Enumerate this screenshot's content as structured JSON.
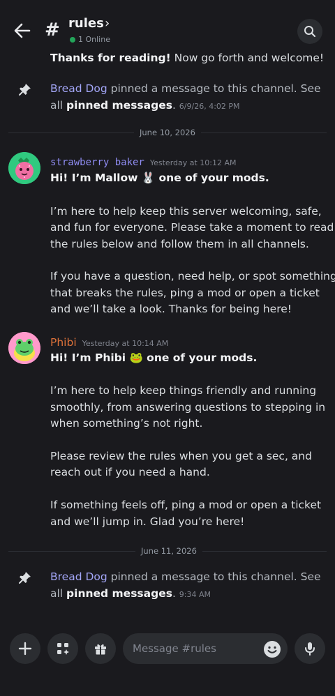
{
  "header": {
    "channel_name": "rules",
    "chevron": "›",
    "online_text": "1 Online"
  },
  "top_message": {
    "bold": "Thanks for reading!",
    "rest": " Now go forth and welcome!"
  },
  "pin_1": {
    "user": "Bread Dog",
    "text1": " pinned a message to this channel. See",
    "text2a": "all ",
    "link": "pinned messages",
    "text2b": ". ",
    "time": "6/9/26, 4:02 PM"
  },
  "divider_1": "June 10, 2026",
  "msg_1": {
    "username": "strawberry baker",
    "username_color": "#8f8cf2",
    "timestamp": "Yesterday at 10:12 AM",
    "title_a": "Hi! I’m Mallow ",
    "title_emoji": "🐰",
    "title_b": " one of your mods.",
    "p1": [
      "I’m here to help keep this server welcoming, safe,",
      "and fun for everyone. Please take a moment to read",
      "the rules below and follow them in all channels."
    ],
    "p2": [
      "If you have a question, need help, or spot something",
      "that breaks the rules, ping a mod or open a ticket",
      "and we’ll take a look. Thanks for being here!"
    ]
  },
  "msg_2": {
    "username": "Phibi",
    "username_color": "#e0733a",
    "timestamp": "Yesterday at 10:14 AM",
    "title_a": "Hi! I’m Phibi ",
    "title_emoji": "🐸",
    "title_b": " one of your mods.",
    "p1": [
      "I’m here to help keep things friendly and running",
      "smoothly, from answering questions to stepping in",
      "when something’s not right."
    ],
    "p2": [
      "Please review the rules when you get a sec, and",
      "reach out if you need a hand."
    ],
    "p3": [
      "If something feels off, ping a mod or open a ticket",
      "and we’ll jump in. Glad you’re here!"
    ]
  },
  "divider_2": "June 11, 2026",
  "pin_2": {
    "user": "Bread Dog",
    "text1": " pinned a message to this channel. See",
    "text2a": "all ",
    "link": "pinned messages",
    "text2b": ". ",
    "time": "9:34 AM"
  },
  "composer": {
    "placeholder": "Message #rules"
  },
  "icons": [
    "back-arrow-icon",
    "hash-icon",
    "search-icon",
    "pin-icon",
    "plus-icon",
    "apps-icon",
    "gift-icon",
    "emoji-icon",
    "mic-icon"
  ],
  "colors": {
    "background": "#1a1a1e",
    "online": "#23a55a",
    "mention": "#a3a6f7"
  }
}
